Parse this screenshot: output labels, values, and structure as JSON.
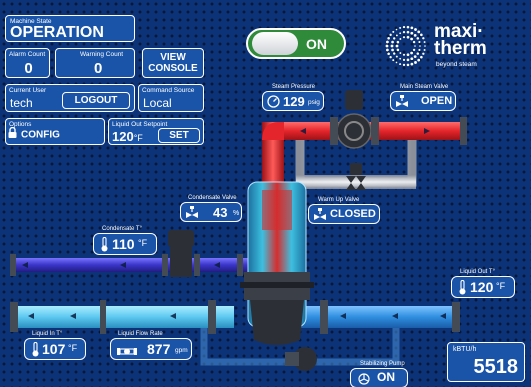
{
  "machine_state": {
    "label": "Machine State",
    "value": "OPERATION"
  },
  "alarm_count": {
    "label": "Alarm Count",
    "value": "0"
  },
  "warning_count": {
    "label": "Warning Count",
    "value": "0"
  },
  "view_console": {
    "line1": "VIEW",
    "line2": "CONSOLE"
  },
  "current_user": {
    "label": "Current User",
    "value": "tech",
    "logout": "LOGOUT"
  },
  "command_source": {
    "label": "Command Source",
    "value": "Local"
  },
  "options": {
    "label": "Options",
    "config": "CONFIG"
  },
  "liquid_out_setpoint": {
    "label": "Liquid Out Setpoint",
    "value": "120",
    "unit": "°F",
    "set": "SET"
  },
  "power_toggle": {
    "state": "ON"
  },
  "logo": {
    "line1": "maxi·",
    "line2": "therm",
    "tagline": "beyond steam"
  },
  "steam_pressure": {
    "label": "Steam Pressure",
    "value": "129",
    "unit": "psig"
  },
  "main_steam_valve": {
    "label": "Main Steam Valve",
    "value": "OPEN"
  },
  "warm_up_valve": {
    "label": "Warm Up Valve",
    "value": "CLOSED"
  },
  "condensate_valve": {
    "label": "Condensate Valve",
    "value": "43",
    "unit": "%"
  },
  "condensate_temp": {
    "label": "Condensate T°",
    "value": "110",
    "unit": "°F"
  },
  "liquid_out_temp": {
    "label": "Liquid Out T°",
    "value": "120",
    "unit": "°F"
  },
  "liquid_in_temp": {
    "label": "Liquid In T°",
    "value": "107",
    "unit": "°F"
  },
  "liquid_flow_rate": {
    "label": "Liquid Flow Rate",
    "value": "877",
    "unit": "gpm"
  },
  "stabilizing_pump": {
    "label": "Stabilizing Pump",
    "value": "ON"
  },
  "kbtu": {
    "label": "kBTU/h",
    "value": "5518"
  },
  "colors": {
    "background": "#0c3378",
    "panel": "#1a54a8",
    "steam": "#e4252b",
    "liquid_in": "#5ec8f0",
    "liquid_out": "#2f8fe0",
    "condensate": "#3a35c8",
    "toggle_on": "#2f8a3a"
  },
  "icons": {
    "lock": "lock-icon",
    "thermometer": "thermometer-icon",
    "valve": "valve-icon",
    "gauge": "gauge-icon",
    "flow": "flow-meter-icon",
    "pump": "pump-icon"
  }
}
